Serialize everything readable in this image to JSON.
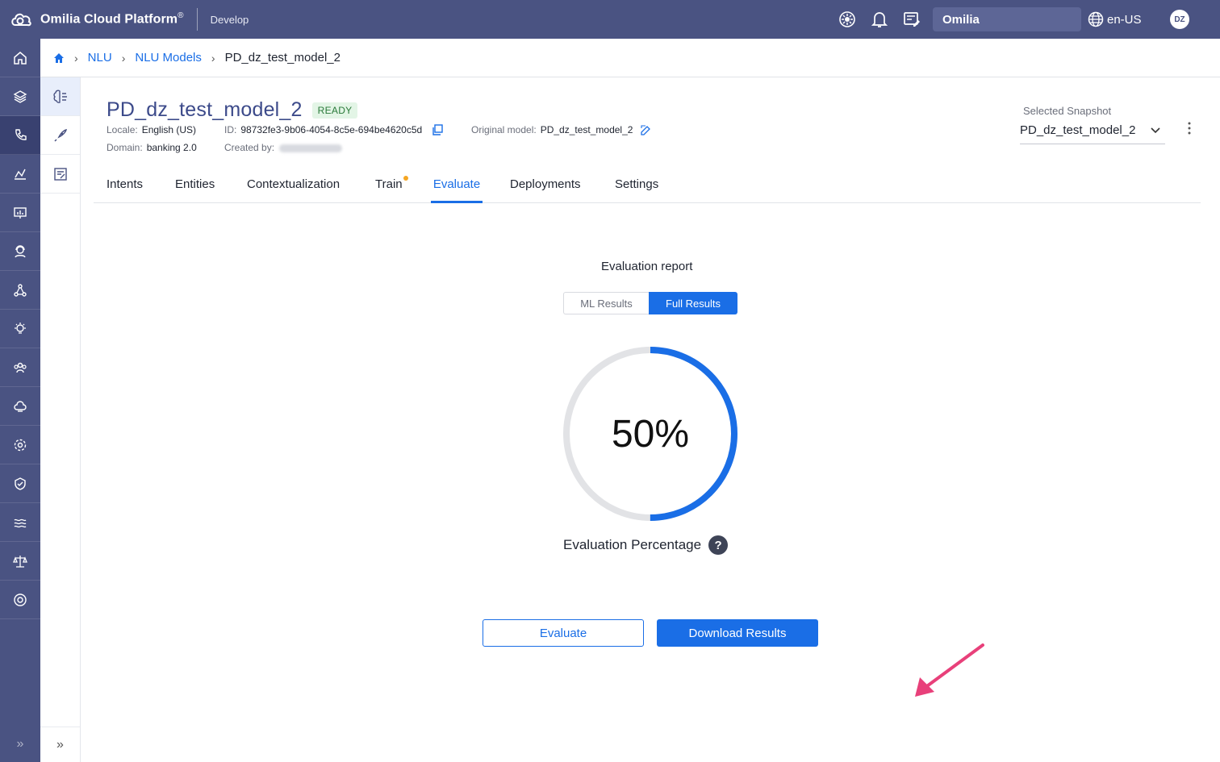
{
  "header": {
    "brand": "Omilia Cloud Platform",
    "brand_mark": "®",
    "environment": "Develop",
    "organization": "Omilia",
    "language": "en-US",
    "user_initials": "DZ"
  },
  "breadcrumb": {
    "items": [
      "NLU",
      "NLU Models",
      "PD_dz_test_model_2"
    ]
  },
  "model": {
    "title": "PD_dz_test_model_2",
    "status": "READY",
    "locale_label": "Locale:",
    "locale": "English (US)",
    "domain_label": "Domain:",
    "domain": "banking 2.0",
    "id_label": "ID:",
    "id": "98732fe3-9b06-4054-8c5e-694be4620c5d",
    "created_by_label": "Created by:",
    "original_label": "Original model:",
    "original": "PD_dz_test_model_2"
  },
  "snapshot": {
    "label": "Selected Snapshot",
    "value": "PD_dz_test_model_2"
  },
  "tabs": [
    {
      "label": "Intents"
    },
    {
      "label": "Entities"
    },
    {
      "label": "Contextualization"
    },
    {
      "label": "Train"
    },
    {
      "label": "Evaluate"
    },
    {
      "label": "Deployments"
    },
    {
      "label": "Settings"
    }
  ],
  "active_tab": "Evaluate",
  "report": {
    "title": "Evaluation report",
    "toggle": [
      "ML Results",
      "Full Results"
    ],
    "selected_toggle": "Full Results",
    "percentage_text": "50%",
    "percentage_value": 0.5,
    "percentage_label": "Evaluation Percentage",
    "help_glyph": "?"
  },
  "actions": {
    "evaluate": "Evaluate",
    "download": "Download Results"
  },
  "colors": {
    "topbar": "#4a5382",
    "accent": "#1a6ee6",
    "title": "#3c4a8a",
    "ready_bg": "#e3f5e6",
    "annotation_arrow": "#e8407a"
  },
  "icons": {
    "leftnav": [
      "home-icon",
      "layers-icon",
      "phone-icon",
      "analytics-icon",
      "presentation-icon",
      "support-agent-icon",
      "network-icon",
      "bulb-icon",
      "team-icon",
      "cloud-icon",
      "gear-icon",
      "shield-check-icon",
      "waves-icon",
      "scale-icon",
      "lifebuoy-icon"
    ],
    "subnav": [
      "brain-icon",
      "rocket-icon",
      "checklist-icon"
    ]
  }
}
